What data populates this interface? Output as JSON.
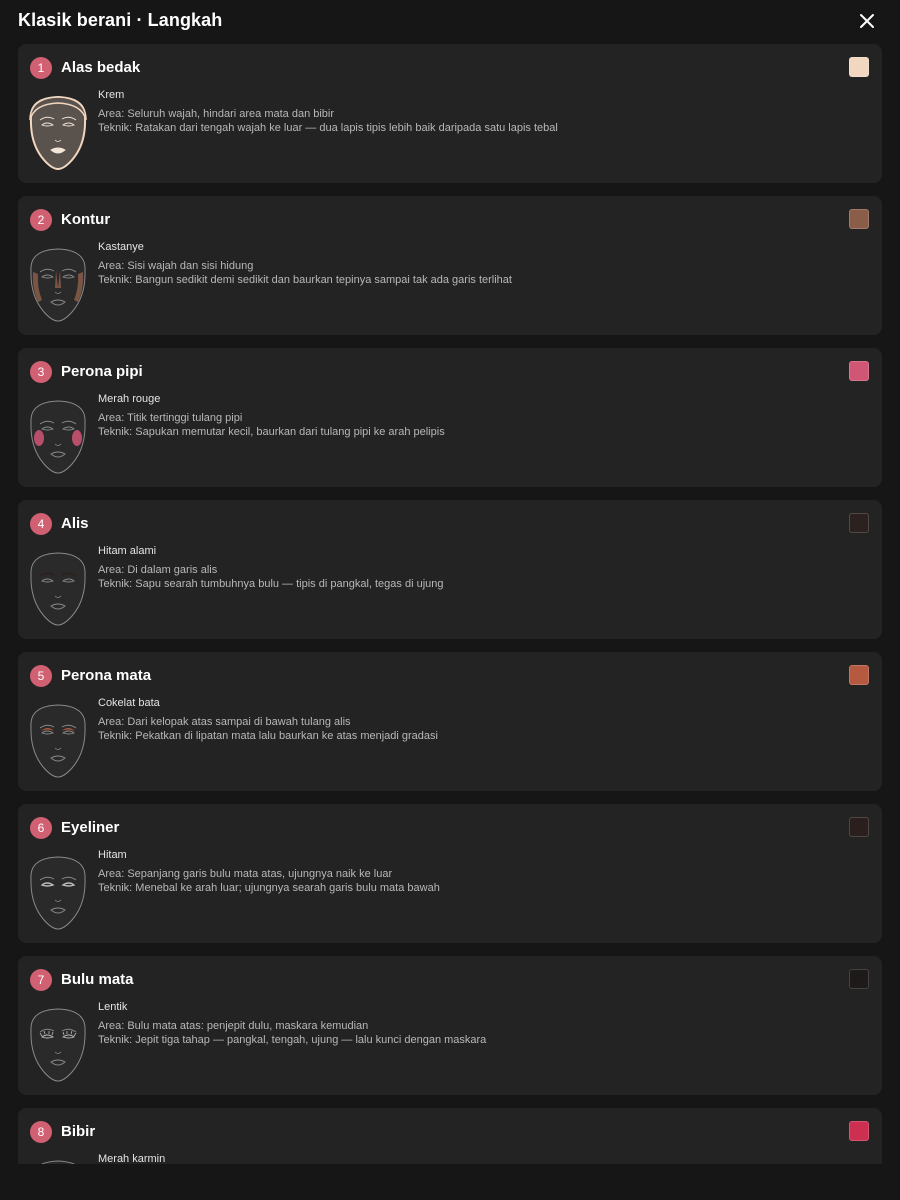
{
  "header": {
    "title": "Klasik berani · Langkah",
    "close_icon": "close-icon"
  },
  "steps": [
    {
      "number": "1",
      "name": "Alas bedak",
      "color_name": "Krem",
      "swatch": "#f1d6c0",
      "area": "Area: Seluruh wajah, hindari area mata dan bibir",
      "technique": "Teknik: Ratakan dari tengah wajah ke luar — dua lapis tipis lebih baik daripada satu lapis tebal",
      "highlight": "foundation"
    },
    {
      "number": "2",
      "name": "Kontur",
      "color_name": "Kastanye",
      "swatch": "#8a5d48",
      "area": "Area: Sisi wajah dan sisi hidung",
      "technique": "Teknik: Bangun sedikit demi sedikit dan baurkan tepinya sampai tak ada garis terlihat",
      "highlight": "contour"
    },
    {
      "number": "3",
      "name": "Perona pipi",
      "color_name": "Merah rouge",
      "swatch": "#d05675",
      "area": "Area: Titik tertinggi tulang pipi",
      "technique": "Teknik: Sapukan memutar kecil, baurkan dari tulang pipi ke arah pelipis",
      "highlight": "blush"
    },
    {
      "number": "4",
      "name": "Alis",
      "color_name": "Hitam alami",
      "swatch": "#2b211e",
      "area": "Area: Di dalam garis alis",
      "technique": "Teknik: Sapu searah tumbuhnya bulu — tipis di pangkal, tegas di ujung",
      "highlight": "brows"
    },
    {
      "number": "5",
      "name": "Perona mata",
      "color_name": "Cokelat bata",
      "swatch": "#b55a40",
      "area": "Area: Dari kelopak atas sampai di bawah tulang alis",
      "technique": "Teknik: Pekatkan di lipatan mata lalu baurkan ke atas menjadi gradasi",
      "highlight": "eyeshadow"
    },
    {
      "number": "6",
      "name": "Eyeliner",
      "color_name": "Hitam",
      "swatch": "#2a1f1d",
      "area": "Area: Sepanjang garis bulu mata atas, ujungnya naik ke luar",
      "technique": "Teknik: Menebal ke arah luar; ujungnya searah garis bulu mata bawah",
      "highlight": "liner"
    },
    {
      "number": "7",
      "name": "Bulu mata",
      "color_name": "Lentik",
      "swatch": "#1d1a19",
      "area": "Area: Bulu mata atas: penjepit dulu, maskara kemudian",
      "technique": "Teknik: Jepit tiga tahap — pangkal, tengah, ujung — lalu kunci dengan maskara",
      "highlight": "lashes"
    },
    {
      "number": "8",
      "name": "Bibir",
      "color_name": "Merah karmin",
      "swatch": "#cc2f4f",
      "area": "",
      "technique": "",
      "highlight": "lips"
    }
  ]
}
